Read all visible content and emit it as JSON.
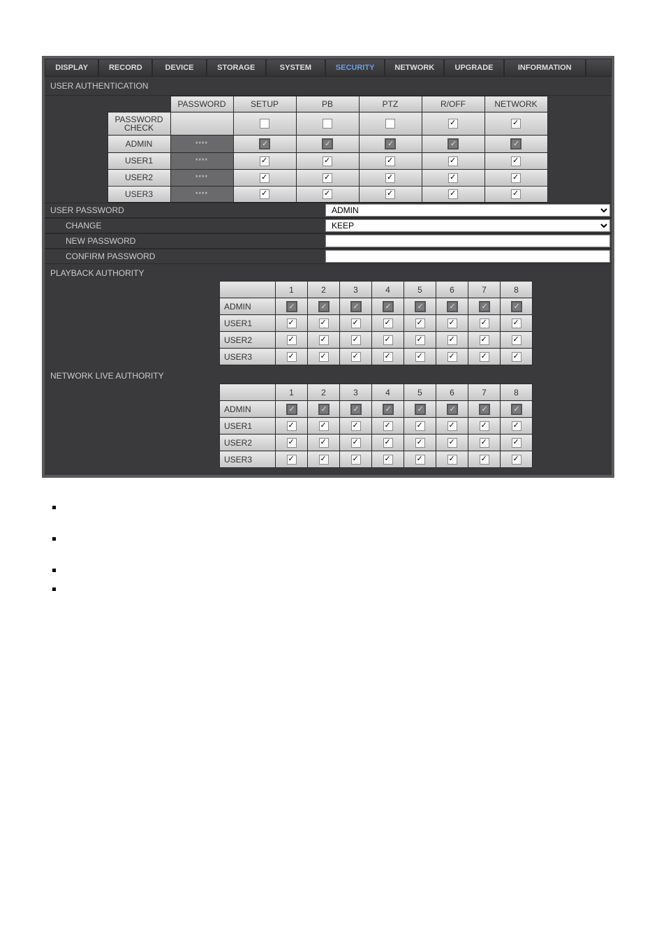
{
  "tabs": {
    "display": "DISPLAY",
    "record": "RECORD",
    "device": "DEVICE",
    "storage": "STORAGE",
    "system": "SYSTEM",
    "security": "SECURITY",
    "network": "NETWORK",
    "upgrade": "UPGRADE",
    "information": "INFORMATION"
  },
  "sections": {
    "user_auth": "USER AUTHENTICATION",
    "user_password": "USER PASSWORD",
    "change": "CHANGE",
    "new_password": "NEW PASSWORD",
    "confirm_password": "CONFIRM PASSWORD",
    "playback_authority": "PLAYBACK AUTHORITY",
    "network_live_authority": "NETWORK LIVE AUTHORITY"
  },
  "auth_headers": {
    "password": "PASSWORD",
    "setup": "SETUP",
    "pb": "PB",
    "ptz": "PTZ",
    "roff": "R/OFF",
    "network": "NETWORK",
    "password_check": "PASSWORD CHECK"
  },
  "auth_rows": [
    {
      "name": "ADMIN",
      "pw": "****",
      "setup": "dark",
      "pb": "dark",
      "ptz": "dark",
      "roff": "dark",
      "net": "dark"
    },
    {
      "name": "USER1",
      "pw": "****",
      "setup": "on",
      "pb": "on",
      "ptz": "on",
      "roff": "on",
      "net": "on"
    },
    {
      "name": "USER2",
      "pw": "****",
      "setup": "on",
      "pb": "on",
      "ptz": "on",
      "roff": "on",
      "net": "on"
    },
    {
      "name": "USER3",
      "pw": "****",
      "setup": "on",
      "pb": "on",
      "ptz": "on",
      "roff": "on",
      "net": "on"
    }
  ],
  "pw_check": {
    "setup": "off",
    "pb": "off",
    "ptz": "off",
    "roff": "on",
    "net": "on"
  },
  "dropdowns": {
    "user_password_value": "ADMIN",
    "change_value": "KEEP"
  },
  "channels": [
    "1",
    "2",
    "3",
    "4",
    "5",
    "6",
    "7",
    "8"
  ],
  "playback_rows": [
    {
      "name": "ADMIN",
      "style": "dark"
    },
    {
      "name": "USER1",
      "style": "on"
    },
    {
      "name": "USER2",
      "style": "on"
    },
    {
      "name": "USER3",
      "style": "on"
    }
  ],
  "netlive_rows": [
    {
      "name": "ADMIN",
      "style": "dark"
    },
    {
      "name": "USER1",
      "style": "on"
    },
    {
      "name": "USER2",
      "style": "on"
    },
    {
      "name": "USER3",
      "style": "on"
    }
  ]
}
